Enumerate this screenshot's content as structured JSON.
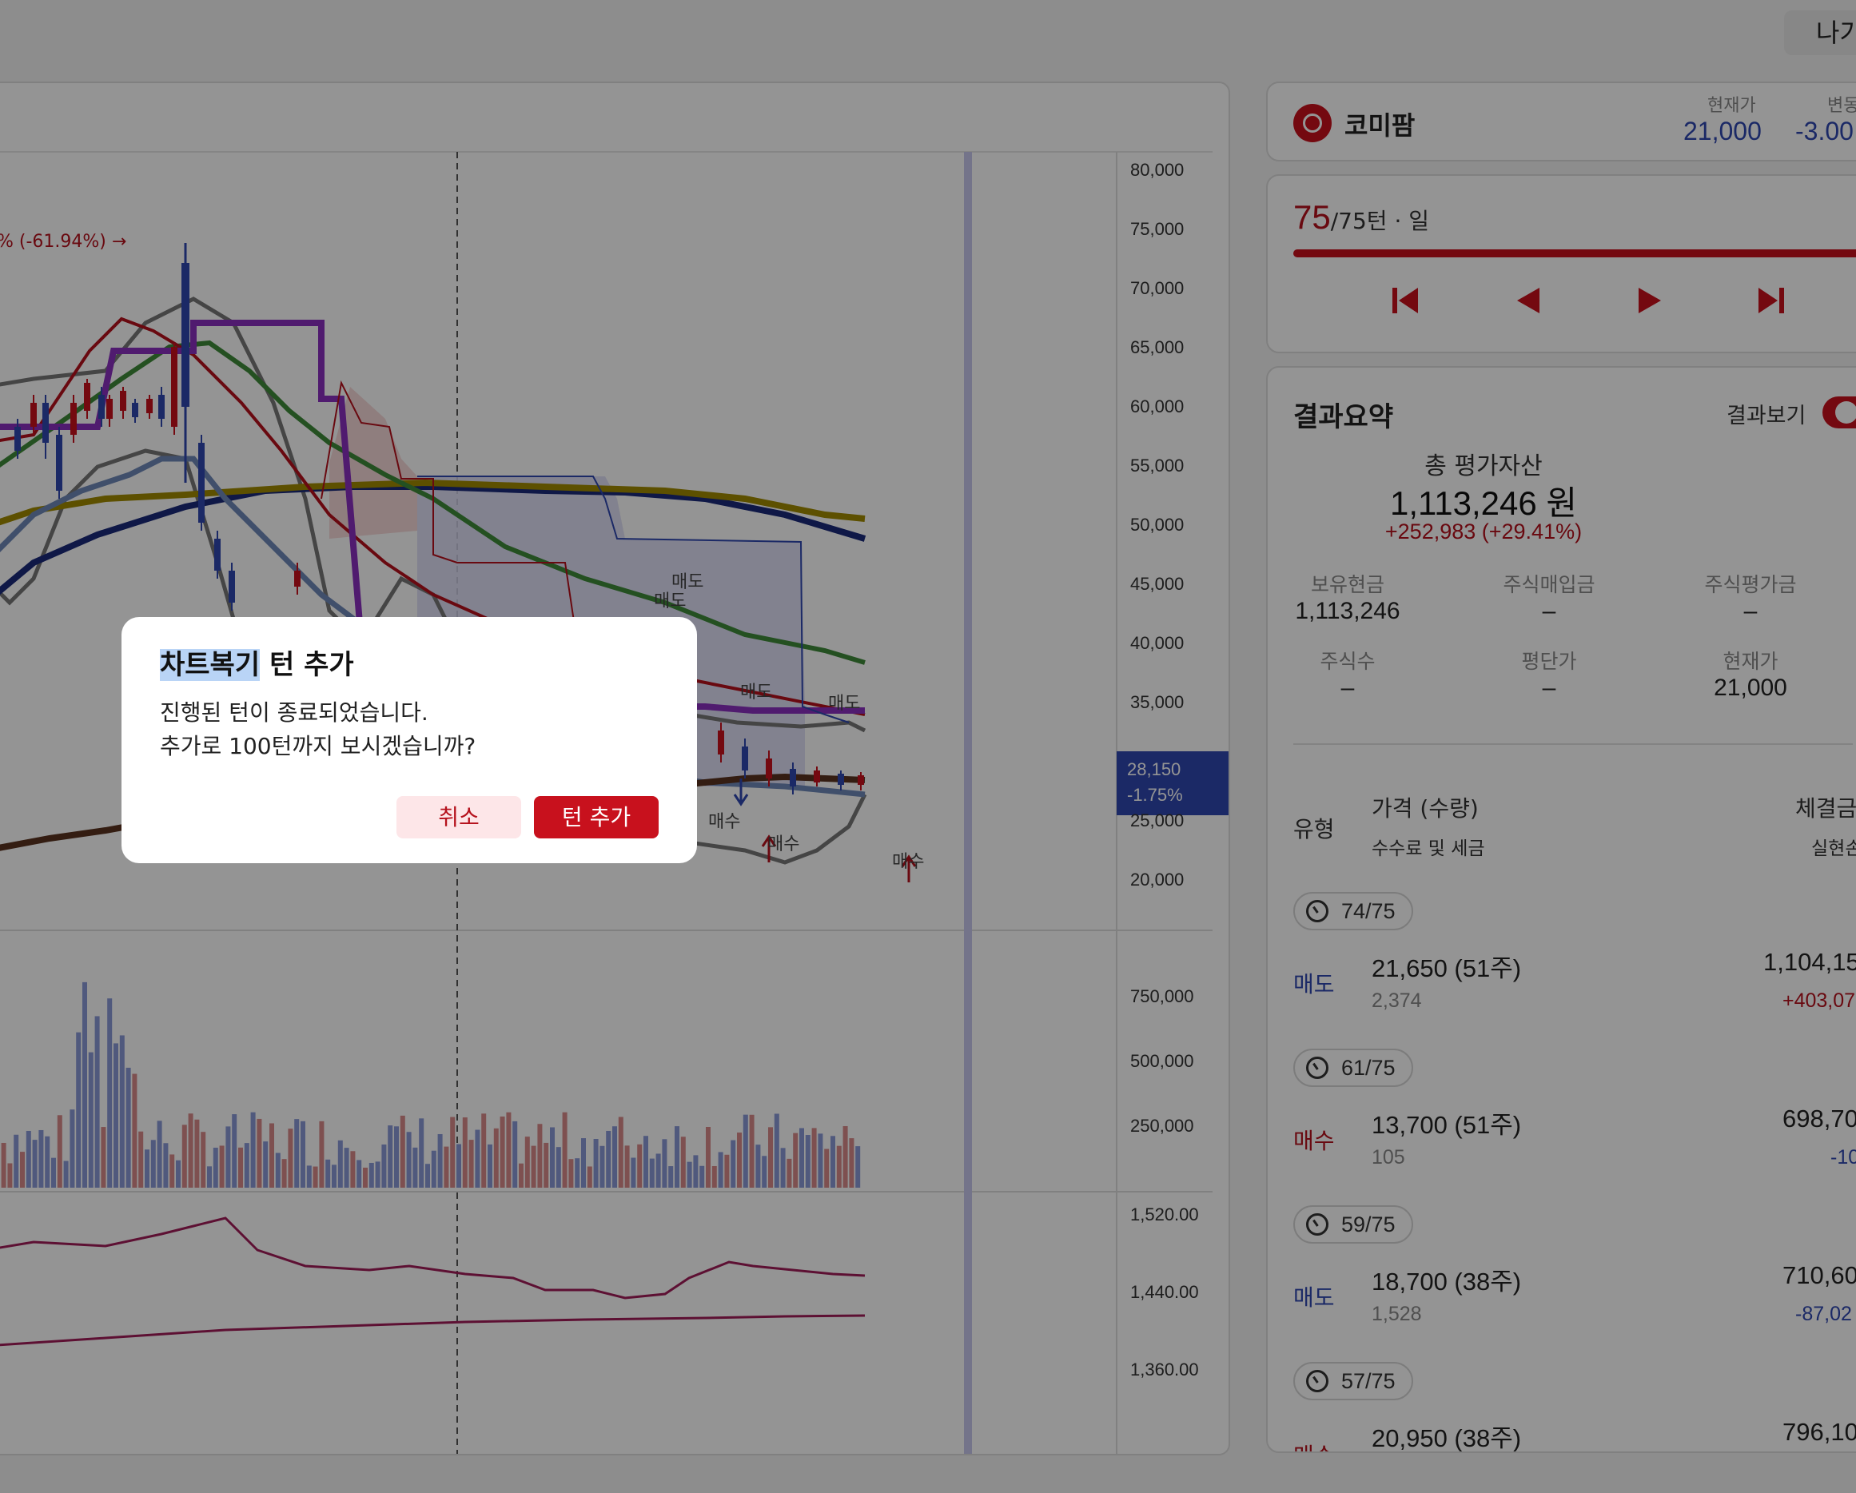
{
  "topbar": {
    "exit_label": "나가"
  },
  "chart": {
    "y_ticks_price": [
      "80,000",
      "75,000",
      "70,000",
      "65,000",
      "60,000",
      "55,000",
      "50,000",
      "45,000",
      "40,000",
      "35,000",
      "25,000",
      "20,000"
    ],
    "y_ticks_volume": [
      "750,000",
      "500,000",
      "250,000"
    ],
    "y_ticks_indicator": [
      "1,520.00",
      "1,440.00",
      "1,360.00"
    ],
    "price_badge": {
      "price": "28,150",
      "change": "-1.75%"
    },
    "high_annotation": "% (-61.94%) →",
    "trade_markers": [
      {
        "label": "매도",
        "kind": "sell"
      },
      {
        "label": "매도",
        "kind": "sell"
      },
      {
        "label": "매도",
        "kind": "sell"
      },
      {
        "label": "매도",
        "kind": "sell"
      },
      {
        "label": "매수",
        "kind": "buy"
      },
      {
        "label": "매수",
        "kind": "buy"
      },
      {
        "label": "매수",
        "kind": "buy"
      }
    ],
    "colors": {
      "up": "#c8111d",
      "down": "#2f47b0",
      "ma_purple": "#8b2fc0",
      "ma_olive": "#a08a00",
      "ma_green": "#3f8a3a",
      "ma_navy": "#1a2a7a",
      "ma_brown": "#5a3320",
      "bollinger": "#777777"
    }
  },
  "stock": {
    "name": "코미팜",
    "current_label": "현재가",
    "current_value": "21,000",
    "change_label": "변동",
    "change_value": "-3.00"
  },
  "turn": {
    "current": "75",
    "total_text": "/75턴 · 일",
    "progress": 1.0
  },
  "summary": {
    "title": "결과요약",
    "toggle_label": "결과보기",
    "total_label": "총 평가자산",
    "total_value": "1,113,246 원",
    "total_change": "+252,983 (+29.41%)",
    "stats": [
      {
        "label": "보유현금",
        "value": "1,113,246"
      },
      {
        "label": "주식매입금",
        "value": "–"
      },
      {
        "label": "주식평가금",
        "value": "–"
      },
      {
        "label": "주식수",
        "value": "–"
      },
      {
        "label": "평단가",
        "value": "–"
      },
      {
        "label": "현재가",
        "value": "21,000"
      }
    ],
    "table_header": {
      "type": "유형",
      "price_qty": "가격 (수량)",
      "fee_tax": "수수료 및 세금",
      "exec_amount": "체결금",
      "realized": "실현손"
    },
    "trades": [
      {
        "turn": "74/75",
        "type": "매도",
        "price_qty": "21,650 (51주)",
        "fee": "2,374",
        "amount": "1,104,15",
        "pnl": "+403,07"
      },
      {
        "turn": "61/75",
        "type": "매수",
        "price_qty": "13,700 (51주)",
        "fee": "105",
        "amount": "698,70",
        "pnl": "-10"
      },
      {
        "turn": "59/75",
        "type": "매도",
        "price_qty": "18,700 (38주)",
        "fee": "1,528",
        "amount": "710,60",
        "pnl": "-87,02"
      },
      {
        "turn": "57/75",
        "type": "매수",
        "price_qty": "20,950 (38주)",
        "fee": "",
        "amount": "796,10",
        "pnl": ""
      }
    ]
  },
  "modal": {
    "title_highlight": "차트복기",
    "title_rest": " 턴 추가",
    "line1": "진행된 턴이 종료되었습니다.",
    "line2": "추가로 100턴까지 보시겠습니까?",
    "cancel": "취소",
    "confirm": "턴 추가"
  }
}
